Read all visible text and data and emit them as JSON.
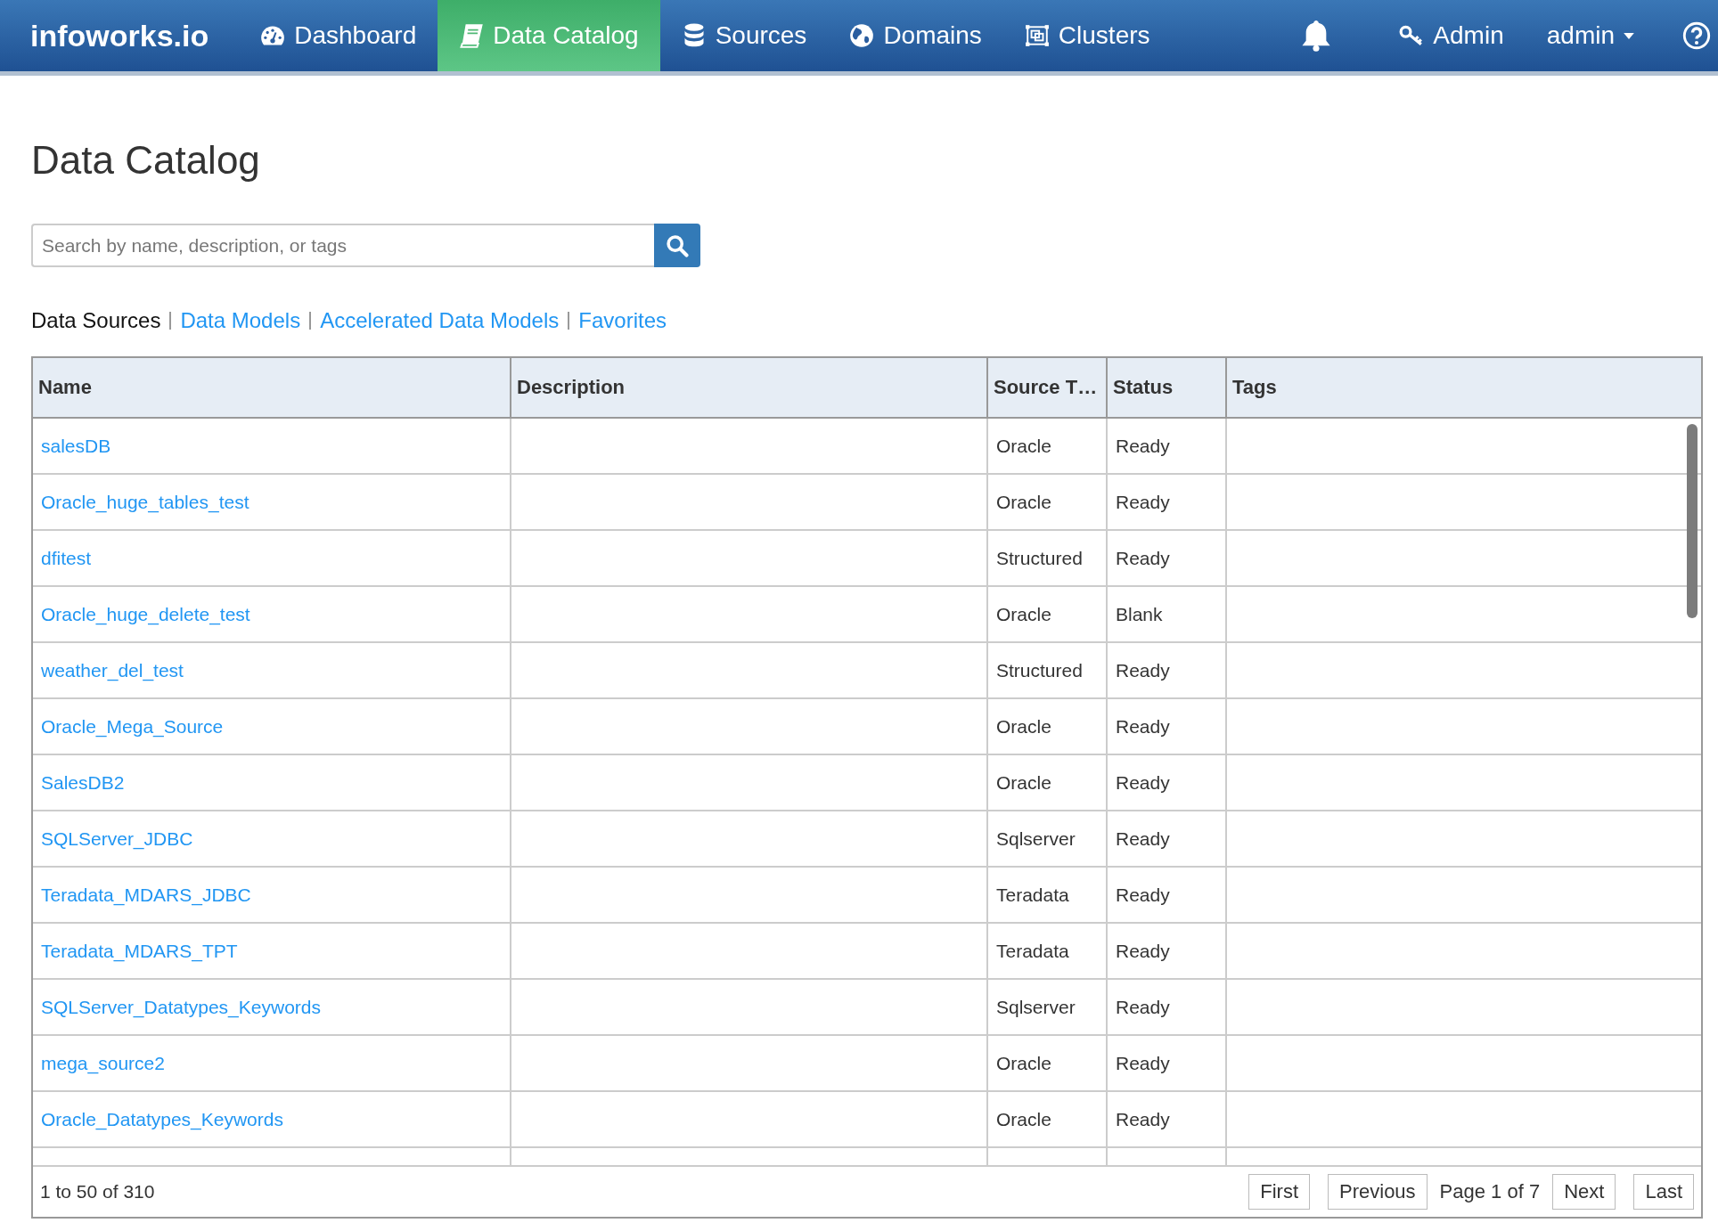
{
  "navbar": {
    "logo": "infoworks.io",
    "items": [
      {
        "label": "Dashboard",
        "selected": false
      },
      {
        "label": "Data Catalog",
        "selected": true
      },
      {
        "label": "Sources",
        "selected": false
      },
      {
        "label": "Domains",
        "selected": false
      },
      {
        "label": "Clusters",
        "selected": false
      }
    ],
    "right": [
      {
        "kind": "bell"
      },
      {
        "kind": "link",
        "label": "Admin"
      },
      {
        "kind": "dropdown",
        "label": "admin"
      },
      {
        "kind": "help"
      }
    ]
  },
  "page_title": "Data Catalog",
  "search": {
    "placeholder": "Search by name, description, or tags"
  },
  "tabs": [
    {
      "label": "Data Sources",
      "selected": true
    },
    {
      "label": "Data Models",
      "selected": false
    },
    {
      "label": "Accelerated Data Models",
      "selected": false
    },
    {
      "label": "Favorites",
      "selected": false
    }
  ],
  "table": {
    "columns": [
      "Name",
      "Description",
      "Source T…",
      "Status",
      "Tags"
    ],
    "rows": [
      {
        "name": "salesDB",
        "source_type": "Oracle",
        "status": "Ready"
      },
      {
        "name": "Oracle_huge_tables_test",
        "source_type": "Oracle",
        "status": "Ready"
      },
      {
        "name": "dfitest",
        "source_type": "Structured",
        "status": "Ready"
      },
      {
        "name": "Oracle_huge_delete_test",
        "source_type": "Oracle",
        "status": "Blank"
      },
      {
        "name": "weather_del_test",
        "source_type": "Structured",
        "status": "Ready"
      },
      {
        "name": "Oracle_Mega_Source",
        "source_type": "Oracle",
        "status": "Ready"
      },
      {
        "name": "SalesDB2",
        "source_type": "Oracle",
        "status": "Ready"
      },
      {
        "name": "SQLServer_JDBC",
        "source_type": "Sqlserver",
        "status": "Ready"
      },
      {
        "name": "Teradata_MDARS_JDBC",
        "source_type": "Teradata",
        "status": "Ready"
      },
      {
        "name": "Teradata_MDARS_TPT",
        "source_type": "Teradata",
        "status": "Ready"
      },
      {
        "name": "SQLServer_Datatypes_Keywords",
        "source_type": "Sqlserver",
        "status": "Ready"
      },
      {
        "name": "mega_source2",
        "source_type": "Oracle",
        "status": "Ready"
      },
      {
        "name": "Oracle_Datatypes_Keywords",
        "source_type": "Oracle",
        "status": "Ready"
      }
    ]
  },
  "footer": {
    "count": "1 to 50 of 310",
    "first": "First",
    "previous": "Previous",
    "page": "Page 1 of 7",
    "next": "Next",
    "last": "Last"
  }
}
